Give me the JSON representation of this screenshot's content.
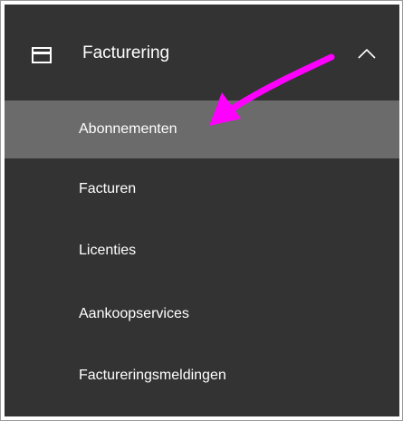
{
  "section": {
    "title": "Facturering",
    "icon": "credit-card-icon",
    "expand_icon": "chevron-up-icon"
  },
  "menu": {
    "items": [
      {
        "label": "Abonnementen",
        "selected": true
      },
      {
        "label": "Facturen"
      },
      {
        "label": "Licenties"
      },
      {
        "label": "Aankoopservices"
      },
      {
        "label": "Factureringsmeldingen"
      }
    ]
  },
  "annotation": {
    "type": "arrow",
    "color": "#ff00ff"
  },
  "colors": {
    "panel": "#333333",
    "selected": "#6b6b6b",
    "text": "#ffffff"
  }
}
